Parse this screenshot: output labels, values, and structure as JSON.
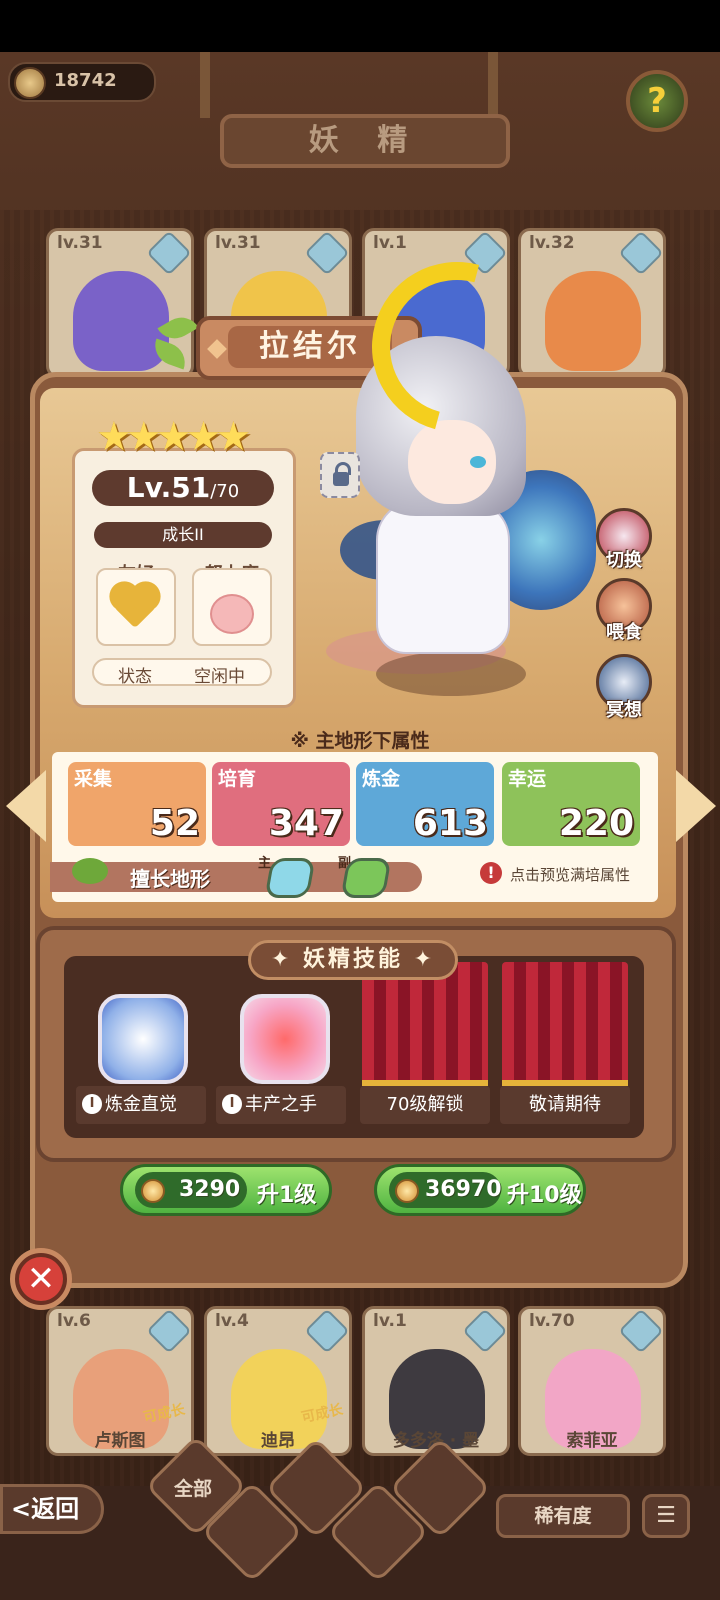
{
  "top": {
    "coins": "18742",
    "title": "妖 精",
    "help_icon": "?"
  },
  "roster_top": [
    {
      "level": "lv.31",
      "color": "#7a62c8"
    },
    {
      "level": "lv.31",
      "color": "#f0c44a"
    },
    {
      "level": "lv.1",
      "color": "#4a6ad0"
    },
    {
      "level": "lv.32",
      "color": "#e88a4a"
    }
  ],
  "roster_bottom": [
    {
      "level": "lv.6",
      "name": "卢斯图",
      "badge": "可成长",
      "color": "#e8a07a"
    },
    {
      "level": "lv.4",
      "name": "迪昂",
      "badge": "可成长",
      "color": "#f2d25a"
    },
    {
      "level": "lv.1",
      "name": "多多洛 · 墨",
      "badge": "",
      "color": "#3e3a40"
    },
    {
      "level": "lv.70",
      "name": "索菲亚",
      "badge": "",
      "color": "#f2a6c6"
    }
  ],
  "stars_strips": [
    "★★★★",
    "★★★"
  ],
  "fairy": {
    "name": "拉结尔",
    "stars": "★★★★★",
    "level": "Lv.51",
    "level_max": "/70",
    "growth": "成长II",
    "friendly_label": "友好",
    "effort_label": "努力度",
    "status_label": "状态",
    "status_value": "空闲中"
  },
  "side_actions": [
    {
      "label": "切换",
      "icon": "switch-icon"
    },
    {
      "label": "喂食",
      "icon": "meat-icon"
    },
    {
      "label": "冥想",
      "icon": "meditate-icon"
    }
  ],
  "attributes": {
    "title": "※ 主地形下属性",
    "items": [
      {
        "name": "采集",
        "value": "52",
        "color": "#f0a56a"
      },
      {
        "name": "培育",
        "value": "347",
        "color": "#e06e7e"
      },
      {
        "name": "炼金",
        "value": "613",
        "color": "#5ea8d8"
      },
      {
        "name": "幸运",
        "value": "220",
        "color": "#8ec25a"
      }
    ],
    "terrain_label": "擅长地形",
    "main_tag": "主",
    "sub_tag": "副",
    "preview_text": "点击预览满培属性",
    "warn_icon": "!"
  },
  "skills": {
    "title": "✦ 妖精技能 ✦",
    "items": [
      {
        "label": "炼金直觉",
        "badge": "I"
      },
      {
        "label": "丰产之手",
        "badge": "I"
      },
      {
        "label": "70级解锁",
        "badge": ""
      },
      {
        "label": "敬请期待",
        "badge": ""
      }
    ]
  },
  "level_up": [
    {
      "cost": "3290",
      "label": "升1级"
    },
    {
      "cost": "36970",
      "label": "升10级"
    }
  ],
  "close_icon": "✕",
  "bottom_nav": {
    "back": "<返回",
    "all": "全部",
    "rarity": "稀有度",
    "sort_icon": "☰"
  },
  "colors": {
    "accent_green": "#4fb341",
    "panel_brown": "#8a5a3c",
    "curtain_red": "#c0283a"
  }
}
